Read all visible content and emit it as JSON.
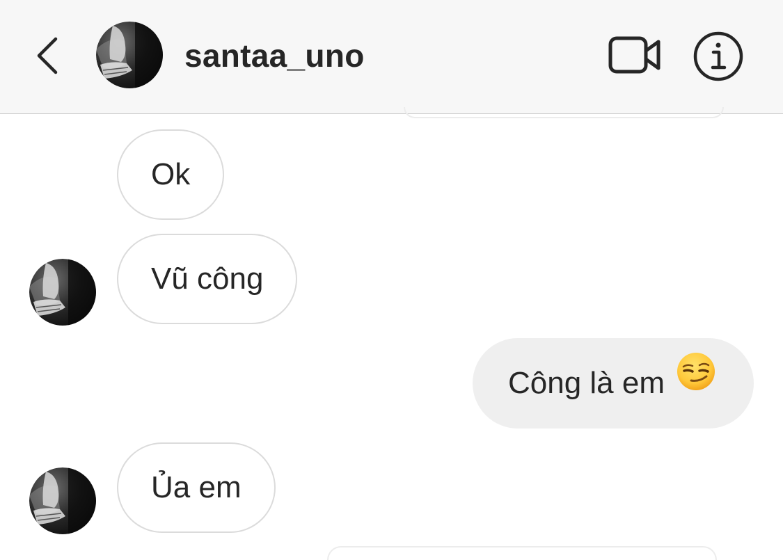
{
  "header": {
    "back_icon": "chevron-left-icon",
    "username": "santaa_uno",
    "video_icon": "video-camera-icon",
    "info_icon": "info-icon"
  },
  "messages": [
    {
      "direction": "incoming",
      "text": "Ok"
    },
    {
      "direction": "incoming",
      "text": "Vũ công"
    },
    {
      "direction": "outgoing",
      "text": "Công là em",
      "emoji": "smirking-face-emoji"
    },
    {
      "direction": "incoming",
      "text": "Ủa em"
    }
  ],
  "colors": {
    "header_bg": "#f7f7f7",
    "outgoing_bubble": "#efefef",
    "incoming_border": "#dbdbdb",
    "text": "#262626"
  }
}
